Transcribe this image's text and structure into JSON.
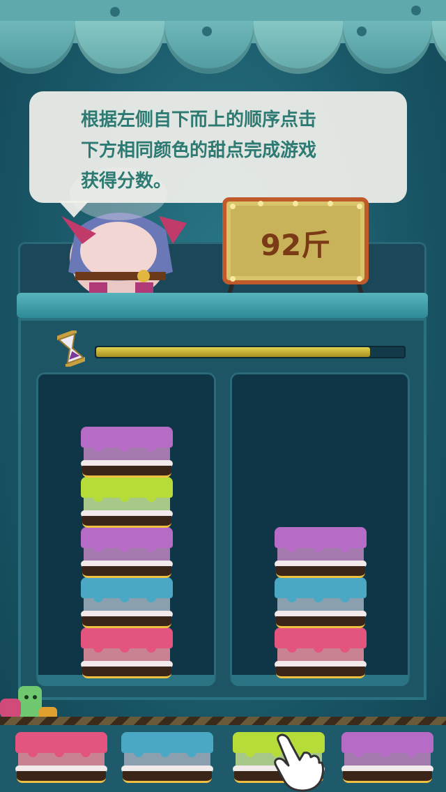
{
  "instruction": {
    "line1": "根据左侧自下而上的顺序点击",
    "line2": "下方相同颜色的甜点完成游戏",
    "line3": "获得分数。"
  },
  "weight_sign": {
    "text": "92斤"
  },
  "timer": {
    "remaining_fraction": 0.89
  },
  "colors": {
    "purple": {
      "top": "#b66bc6",
      "body": "#a47aae"
    },
    "green": {
      "top": "#b6dc3a",
      "body": "#a8c88a"
    },
    "blue": {
      "top": "#4aa8c4",
      "body": "#8aa0ae"
    },
    "pink": {
      "top": "#e3557e",
      "body": "#c88292"
    }
  },
  "stacks": {
    "left": [
      "pink",
      "blue",
      "purple",
      "green",
      "purple"
    ],
    "right": [
      "pink",
      "blue",
      "purple"
    ]
  },
  "tray": [
    "pink",
    "blue",
    "green",
    "purple"
  ],
  "hint": {
    "target_index": 2,
    "icon": "pointing-hand-icon"
  }
}
